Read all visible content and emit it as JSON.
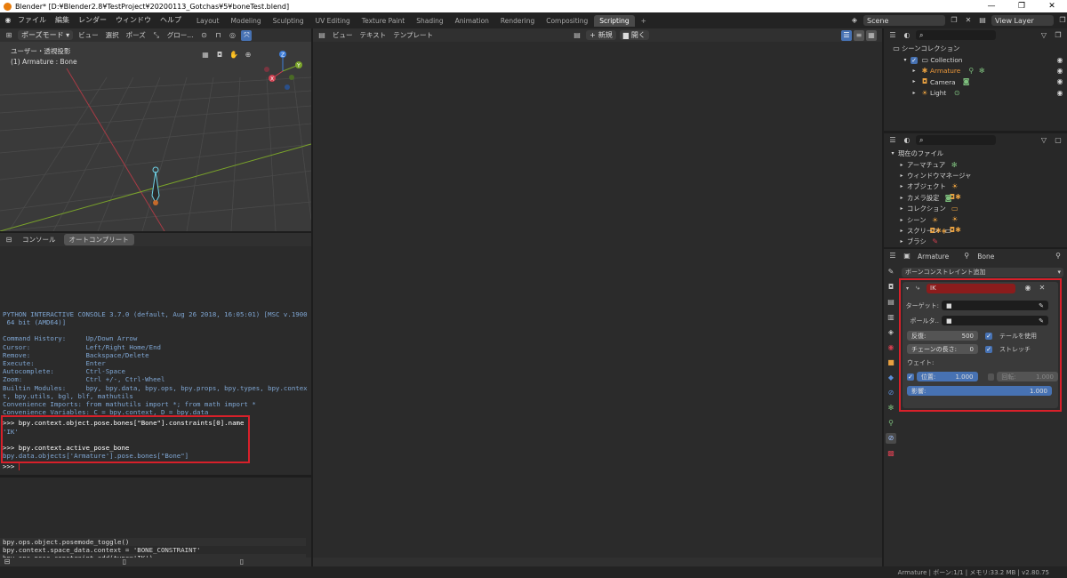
{
  "window": {
    "title": "Blender* [D:¥Blender2.8¥TestProject¥20200113_Gotchas¥5¥boneTest.blend]",
    "minimize": "—",
    "maximize": "❐",
    "close": "✕"
  },
  "menu": [
    "ファイル",
    "編集",
    "レンダー",
    "ウィンドウ",
    "ヘルプ"
  ],
  "workspaces": [
    "Layout",
    "Modeling",
    "Sculpting",
    "UV Editing",
    "Texture Paint",
    "Shading",
    "Animation",
    "Rendering",
    "Compositing",
    "Scripting"
  ],
  "active_workspace": "Scripting",
  "add_tab": "+",
  "scene": {
    "label": "Scene",
    "view_layer": "View Layer"
  },
  "viewport": {
    "mode": "ポーズモード",
    "menus": [
      "ビュー",
      "選択",
      "ポーズ"
    ],
    "transform": "グロー...",
    "view_label": "ユーザー・透視投影",
    "object_label": "(1) Armature : Bone",
    "axes": {
      "z": "Z",
      "y": "Y",
      "x": "X"
    }
  },
  "console": {
    "tabs": [
      "コンソール",
      "オートコンプリート"
    ],
    "header_lines": [
      "PYTHON INTERACTIVE CONSOLE 3.7.0 (default, Aug 26 2018, 16:05:01) [MSC v.1900",
      " 64 bit (AMD64)]"
    ],
    "info_lines": [
      "Command History:     Up/Down Arrow",
      "Cursor:              Left/Right Home/End",
      "Remove:              Backspace/Delete",
      "Execute:             Enter",
      "Autocomplete:        Ctrl-Space",
      "Zoom:                Ctrl +/-, Ctrl-Wheel",
      "Builtin Modules:     bpy, bpy.data, bpy.ops, bpy.props, bpy.types, bpy.contex",
      "t, bpy.utils, bgl, blf, mathutils",
      "Convenience Imports: from mathutils import *; from math import *",
      "Convenience Variables: C = bpy.context, D = bpy.data"
    ],
    "cmd1": ">>> bpy.context.object.pose.bones[\"Bone\"].constraints[0].name",
    "out1": "'IK'",
    "cmd2": ">>> bpy.context.active_pose_bone",
    "out2": "bpy.data.objects['Armature'].pose.bones[\"Bone\"]",
    "prompt": ">>> "
  },
  "info_log": [
    "bpy.ops.object.posemode_toggle()",
    "bpy.context.space_data.context = 'BONE_CONSTRAINT'",
    "bpy.ops.pose.constraint_add(type='IK')"
  ],
  "text_editor": {
    "menus": [
      "ビュー",
      "テキスト",
      "テンプレート"
    ],
    "new": "新規",
    "open": "開く"
  },
  "outliner": {
    "root": "シーンコレクション",
    "collection": "Collection",
    "items": [
      "Armature",
      "Camera",
      "Light"
    ]
  },
  "file_browser": {
    "root": "現在のファイル",
    "items": [
      "アーマチュア",
      "ウィンドウマネージャ",
      "オブジェクト",
      "カメラ設定",
      "コレクション",
      "シーン",
      "スクリーン",
      "ブラシ"
    ]
  },
  "properties": {
    "breadcrumb_object": "Armature",
    "breadcrumb_bone": "Bone",
    "add_constraint": "ボーンコンストレイント追加",
    "constraint": {
      "name": "IK",
      "target_label": "ターゲット:",
      "pole_label": "ポールタ..",
      "iterations_label": "反復:",
      "iterations_value": "500",
      "use_tail": "テールを使用",
      "chain_label": "チェーンの長さ:",
      "chain_value": "0",
      "stretch": "ストレッチ",
      "weight_label": "ウェイト:",
      "position_label": "位置:",
      "position_value": "1.000",
      "rotation_label": "回転:",
      "rotation_value": "1.000",
      "influence_label": "影響:",
      "influence_value": "1.000"
    }
  },
  "status": {
    "text": "Armature | ボーン:1/1 | メモリ:33.2 MB | v2.80.75"
  }
}
